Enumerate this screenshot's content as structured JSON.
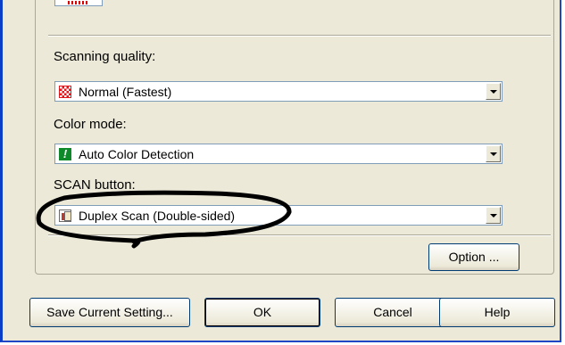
{
  "dialog": {
    "scanning_quality": {
      "label": "Scanning quality:",
      "value": "Normal (Fastest)",
      "icon": "red-checker-icon"
    },
    "color_mode": {
      "label": "Color mode:",
      "value": "Auto Color Detection",
      "icon": "green-exclamation-icon"
    },
    "scan_button": {
      "label": "SCAN button:",
      "value": "Duplex Scan (Double-sided)",
      "icon": "duplex-page-icon"
    },
    "option_button": "Option ...",
    "buttons": {
      "save": "Save Current Setting...",
      "ok": "OK",
      "cancel": "Cancel",
      "help": "Help"
    }
  },
  "colors": {
    "window_border": "#0a3ec9",
    "dialog_bg": "#ece9d8",
    "annotation_ellipse": "#000000"
  }
}
